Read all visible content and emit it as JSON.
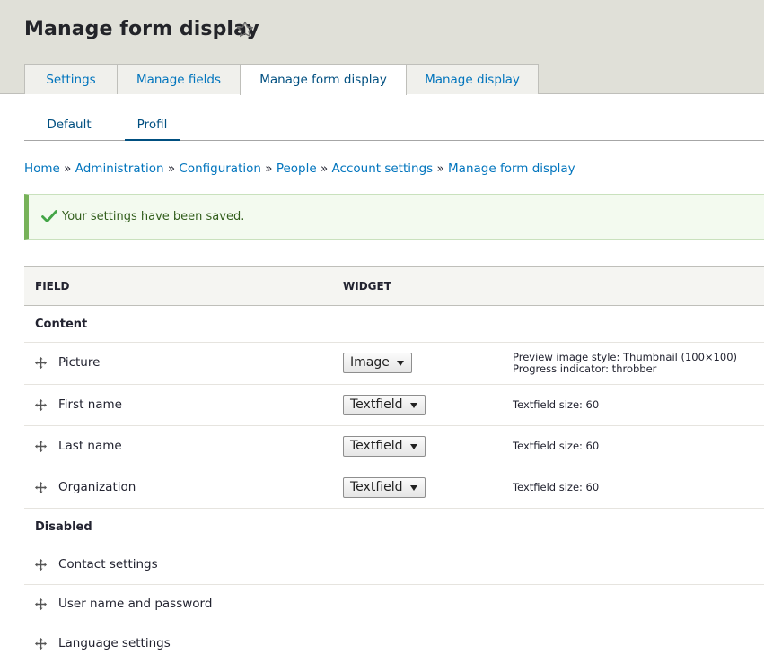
{
  "page": {
    "title": "Manage form display"
  },
  "tabs": [
    {
      "label": "Settings"
    },
    {
      "label": "Manage fields"
    },
    {
      "label": "Manage form display"
    },
    {
      "label": "Manage display"
    }
  ],
  "subtabs": [
    {
      "label": "Default"
    },
    {
      "label": "Profil"
    }
  ],
  "breadcrumb": {
    "items": [
      "Home",
      "Administration",
      "Configuration",
      "People",
      "Account settings",
      "Manage form display"
    ],
    "separator": "»"
  },
  "message": {
    "text": "Your settings have been saved."
  },
  "table": {
    "headers": {
      "field": "FIELD",
      "widget": "WIDGET"
    },
    "regions": {
      "content": "Content",
      "disabled": "Disabled"
    },
    "content_rows": [
      {
        "name": "Picture",
        "widget": "Image",
        "summary": [
          "Preview image style: Thumbnail (100×100)",
          "Progress indicator: throbber"
        ]
      },
      {
        "name": "First name",
        "widget": "Textfield",
        "summary": [
          "Textfield size: 60"
        ]
      },
      {
        "name": "Last name",
        "widget": "Textfield",
        "summary": [
          "Textfield size: 60"
        ]
      },
      {
        "name": "Organization",
        "widget": "Textfield",
        "summary": [
          "Textfield size: 60"
        ]
      }
    ],
    "disabled_rows": [
      {
        "name": "Contact settings"
      },
      {
        "name": "User name and password"
      },
      {
        "name": "Language settings"
      }
    ]
  },
  "colors": {
    "link": "#0074bd",
    "active_tab_text": "#004f80",
    "success_border": "#77b259",
    "header_bg": "#e0e0d8"
  },
  "icons": {
    "favorite": "star-icon",
    "status": "check-icon",
    "row_handle": "drag-handle-icon"
  }
}
